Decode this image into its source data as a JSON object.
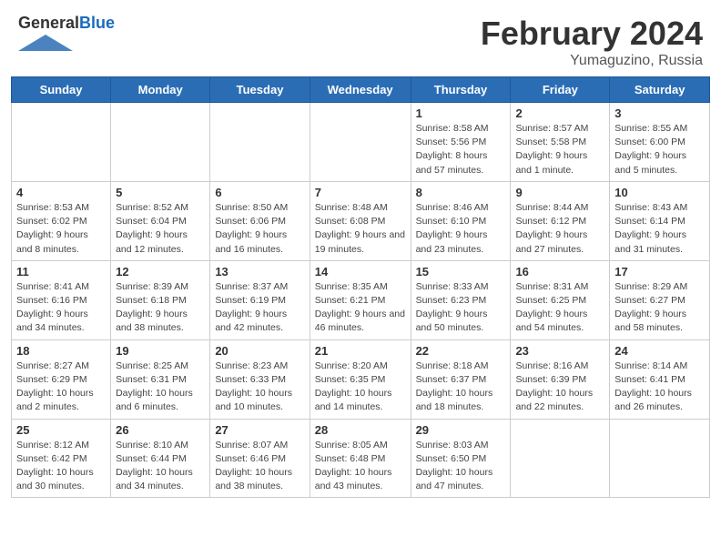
{
  "header": {
    "logo_general": "General",
    "logo_blue": "Blue",
    "month_title": "February 2024",
    "location": "Yumaguzino, Russia"
  },
  "weekdays": [
    "Sunday",
    "Monday",
    "Tuesday",
    "Wednesday",
    "Thursday",
    "Friday",
    "Saturday"
  ],
  "weeks": [
    [
      {
        "day": "",
        "info": ""
      },
      {
        "day": "",
        "info": ""
      },
      {
        "day": "",
        "info": ""
      },
      {
        "day": "",
        "info": ""
      },
      {
        "day": "1",
        "info": "Sunrise: 8:58 AM\nSunset: 5:56 PM\nDaylight: 8 hours and 57 minutes."
      },
      {
        "day": "2",
        "info": "Sunrise: 8:57 AM\nSunset: 5:58 PM\nDaylight: 9 hours and 1 minute."
      },
      {
        "day": "3",
        "info": "Sunrise: 8:55 AM\nSunset: 6:00 PM\nDaylight: 9 hours and 5 minutes."
      }
    ],
    [
      {
        "day": "4",
        "info": "Sunrise: 8:53 AM\nSunset: 6:02 PM\nDaylight: 9 hours and 8 minutes."
      },
      {
        "day": "5",
        "info": "Sunrise: 8:52 AM\nSunset: 6:04 PM\nDaylight: 9 hours and 12 minutes."
      },
      {
        "day": "6",
        "info": "Sunrise: 8:50 AM\nSunset: 6:06 PM\nDaylight: 9 hours and 16 minutes."
      },
      {
        "day": "7",
        "info": "Sunrise: 8:48 AM\nSunset: 6:08 PM\nDaylight: 9 hours and 19 minutes."
      },
      {
        "day": "8",
        "info": "Sunrise: 8:46 AM\nSunset: 6:10 PM\nDaylight: 9 hours and 23 minutes."
      },
      {
        "day": "9",
        "info": "Sunrise: 8:44 AM\nSunset: 6:12 PM\nDaylight: 9 hours and 27 minutes."
      },
      {
        "day": "10",
        "info": "Sunrise: 8:43 AM\nSunset: 6:14 PM\nDaylight: 9 hours and 31 minutes."
      }
    ],
    [
      {
        "day": "11",
        "info": "Sunrise: 8:41 AM\nSunset: 6:16 PM\nDaylight: 9 hours and 34 minutes."
      },
      {
        "day": "12",
        "info": "Sunrise: 8:39 AM\nSunset: 6:18 PM\nDaylight: 9 hours and 38 minutes."
      },
      {
        "day": "13",
        "info": "Sunrise: 8:37 AM\nSunset: 6:19 PM\nDaylight: 9 hours and 42 minutes."
      },
      {
        "day": "14",
        "info": "Sunrise: 8:35 AM\nSunset: 6:21 PM\nDaylight: 9 hours and 46 minutes."
      },
      {
        "day": "15",
        "info": "Sunrise: 8:33 AM\nSunset: 6:23 PM\nDaylight: 9 hours and 50 minutes."
      },
      {
        "day": "16",
        "info": "Sunrise: 8:31 AM\nSunset: 6:25 PM\nDaylight: 9 hours and 54 minutes."
      },
      {
        "day": "17",
        "info": "Sunrise: 8:29 AM\nSunset: 6:27 PM\nDaylight: 9 hours and 58 minutes."
      }
    ],
    [
      {
        "day": "18",
        "info": "Sunrise: 8:27 AM\nSunset: 6:29 PM\nDaylight: 10 hours and 2 minutes."
      },
      {
        "day": "19",
        "info": "Sunrise: 8:25 AM\nSunset: 6:31 PM\nDaylight: 10 hours and 6 minutes."
      },
      {
        "day": "20",
        "info": "Sunrise: 8:23 AM\nSunset: 6:33 PM\nDaylight: 10 hours and 10 minutes."
      },
      {
        "day": "21",
        "info": "Sunrise: 8:20 AM\nSunset: 6:35 PM\nDaylight: 10 hours and 14 minutes."
      },
      {
        "day": "22",
        "info": "Sunrise: 8:18 AM\nSunset: 6:37 PM\nDaylight: 10 hours and 18 minutes."
      },
      {
        "day": "23",
        "info": "Sunrise: 8:16 AM\nSunset: 6:39 PM\nDaylight: 10 hours and 22 minutes."
      },
      {
        "day": "24",
        "info": "Sunrise: 8:14 AM\nSunset: 6:41 PM\nDaylight: 10 hours and 26 minutes."
      }
    ],
    [
      {
        "day": "25",
        "info": "Sunrise: 8:12 AM\nSunset: 6:42 PM\nDaylight: 10 hours and 30 minutes."
      },
      {
        "day": "26",
        "info": "Sunrise: 8:10 AM\nSunset: 6:44 PM\nDaylight: 10 hours and 34 minutes."
      },
      {
        "day": "27",
        "info": "Sunrise: 8:07 AM\nSunset: 6:46 PM\nDaylight: 10 hours and 38 minutes."
      },
      {
        "day": "28",
        "info": "Sunrise: 8:05 AM\nSunset: 6:48 PM\nDaylight: 10 hours and 43 minutes."
      },
      {
        "day": "29",
        "info": "Sunrise: 8:03 AM\nSunset: 6:50 PM\nDaylight: 10 hours and 47 minutes."
      },
      {
        "day": "",
        "info": ""
      },
      {
        "day": "",
        "info": ""
      }
    ]
  ]
}
